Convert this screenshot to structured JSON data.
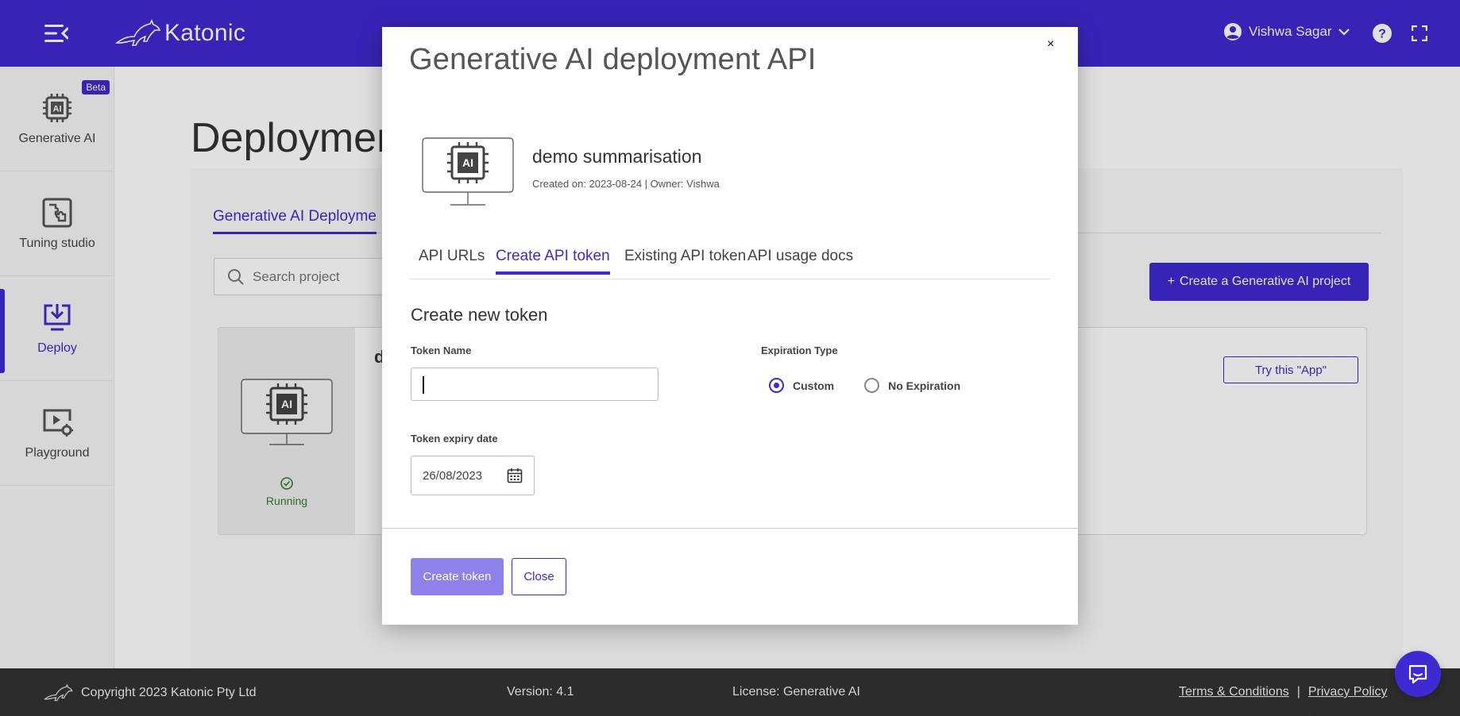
{
  "topbar": {
    "logo_text": "Katonic",
    "user_name": "Vishwa Sagar",
    "brand_color": "#3f2ad1"
  },
  "sidebar": {
    "items": [
      {
        "label": "Generative AI",
        "icon": "ai-chip-icon",
        "badge": "Beta"
      },
      {
        "label": "Tuning studio",
        "icon": "puzzle-icon"
      },
      {
        "label": "Deploy",
        "icon": "deploy-monitor-icon",
        "active": true
      },
      {
        "label": "Playground",
        "icon": "playground-icon"
      }
    ]
  },
  "main": {
    "page_title": "Deploymen",
    "tab_label": "Generative AI Deployme",
    "search_placeholder": "Search project",
    "create_project_label": "Create a Generative AI project",
    "card": {
      "title_initial": "d",
      "status": "Running",
      "try_app_label": "Try this \"App\""
    }
  },
  "modal": {
    "title": "Generative AI deployment API",
    "close_glyph": "×",
    "project_name": "demo summarisation",
    "project_meta": "Created on: 2023-08-24 | Owner: Vishwa",
    "tabs": [
      {
        "label": "API URLs",
        "active": false
      },
      {
        "label": "Create API token",
        "active": true
      },
      {
        "label": "Existing API token",
        "active": false
      },
      {
        "label": "API usage docs",
        "active": false
      }
    ],
    "section_title": "Create new token",
    "token_name_label": "Token Name",
    "token_name_value": "",
    "expiration_type_label": "Expiration Type",
    "expiration_options": [
      {
        "label": "Custom",
        "checked": true
      },
      {
        "label": "No Expiration",
        "checked": false
      }
    ],
    "expiry_date_label": "Token expiry date",
    "expiry_date_value": "26/08/2023",
    "create_token_label": "Create token",
    "close_label": "Close"
  },
  "footer": {
    "copyright": "Copyright 2023 Katonic Pty Ltd",
    "version": "Version: 4.1",
    "license": "License: Generative AI",
    "terms": "Terms & Conditions",
    "separator": "|",
    "privacy": "Privacy Policy"
  }
}
